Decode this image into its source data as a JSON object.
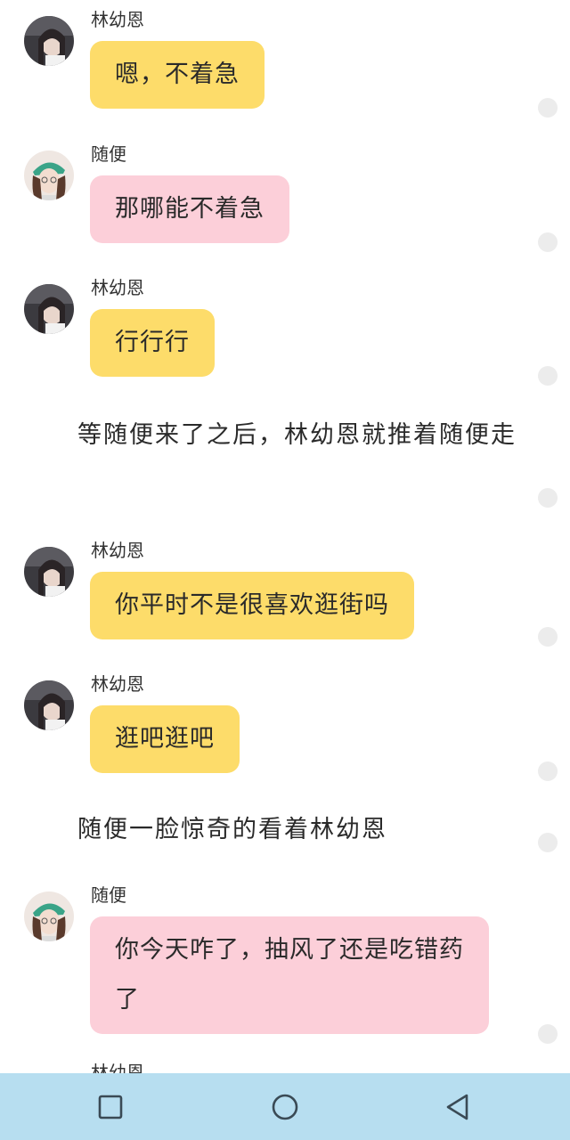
{
  "messages": [
    {
      "sender": "林幼恩",
      "text": "嗯，不着急",
      "color": "#fddc6a"
    },
    {
      "sender": "随便",
      "text": "那哪能不着急",
      "color": "#fccfd9"
    },
    {
      "sender": "林幼恩",
      "text": "行行行",
      "color": "#fddc6a"
    },
    {
      "narration": "等随便来了之后，林幼恩就推着随便走"
    },
    {
      "sender": "林幼恩",
      "text": "你平时不是很喜欢逛街吗",
      "color": "#fddc6a"
    },
    {
      "sender": "林幼恩",
      "text": "逛吧逛吧",
      "color": "#fddc6a"
    },
    {
      "narration": "随便一脸惊奇的看着林幼恩"
    },
    {
      "sender": "随便",
      "text": "你今天咋了，抽风了还是吃错药了",
      "color": "#fccfd9"
    },
    {
      "sender": "林幼恩"
    }
  ],
  "navbar": {
    "background": "#b7def0",
    "buttons": [
      "recent-apps-icon",
      "home-icon",
      "back-icon"
    ]
  }
}
